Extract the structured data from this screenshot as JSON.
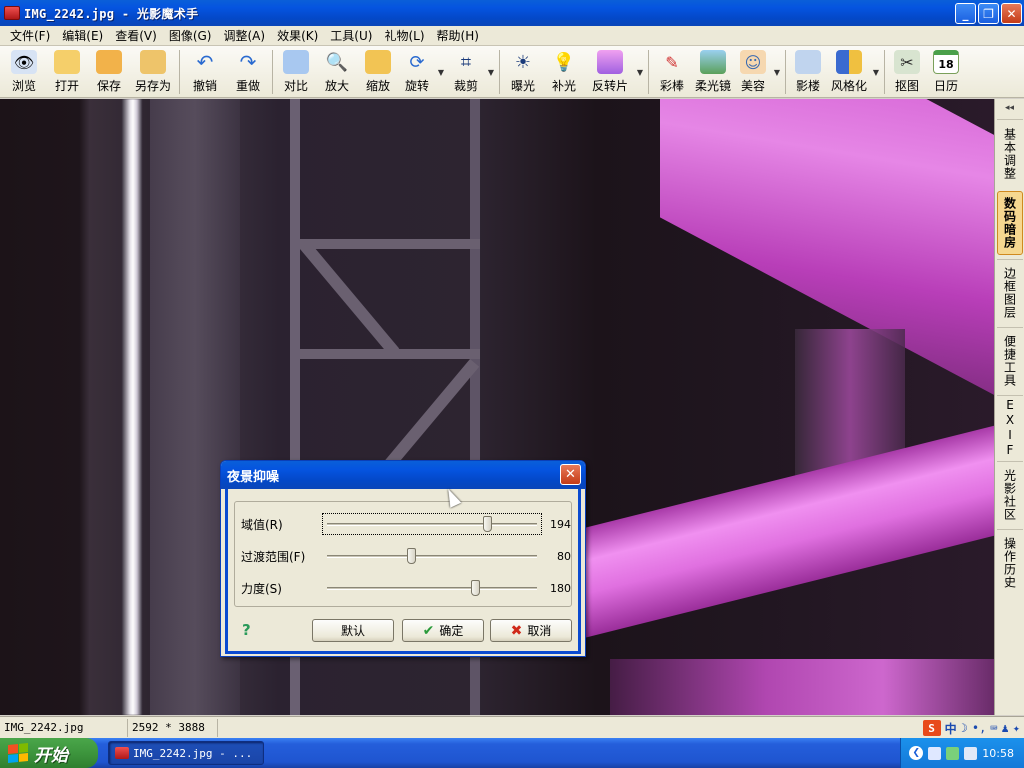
{
  "window": {
    "title": "IMG_2242.jpg - 光影魔术手",
    "controls": {
      "minimize": "_",
      "maximize": "❐",
      "close": "✕"
    }
  },
  "menu": [
    {
      "label": "文件(F)"
    },
    {
      "label": "编辑(E)"
    },
    {
      "label": "查看(V)"
    },
    {
      "label": "图像(G)"
    },
    {
      "label": "调整(A)"
    },
    {
      "label": "效果(K)"
    },
    {
      "label": "工具(U)"
    },
    {
      "label": "礼物(L)"
    },
    {
      "label": "帮助(H)"
    }
  ],
  "toolbar": [
    {
      "label": "浏览",
      "icon": "eye-icon"
    },
    {
      "label": "打开",
      "icon": "folder-icon"
    },
    {
      "label": "保存",
      "icon": "save-icon"
    },
    {
      "label": "另存为",
      "icon": "save-as-icon"
    },
    {
      "label": "撤销",
      "icon": "undo-icon"
    },
    {
      "label": "重做",
      "icon": "redo-icon"
    },
    {
      "label": "对比",
      "icon": "compare-icon"
    },
    {
      "label": "放大",
      "icon": "zoom-in-icon"
    },
    {
      "label": "缩放",
      "icon": "resize-icon"
    },
    {
      "label": "旋转",
      "icon": "rotate-icon"
    },
    {
      "label": "裁剪",
      "icon": "crop-icon"
    },
    {
      "label": "曝光",
      "icon": "exposure-icon"
    },
    {
      "label": "补光",
      "icon": "fill-light-icon"
    },
    {
      "label": "反转片",
      "icon": "film-icon"
    },
    {
      "label": "彩棒",
      "icon": "color-wand-icon"
    },
    {
      "label": "柔光镜",
      "icon": "soft-focus-icon"
    },
    {
      "label": "美容",
      "icon": "beauty-icon"
    },
    {
      "label": "影楼",
      "icon": "studio-icon"
    },
    {
      "label": "风格化",
      "icon": "stylize-icon"
    },
    {
      "label": "抠图",
      "icon": "cutout-icon"
    },
    {
      "label": "日历",
      "icon": "calendar-icon",
      "day": "18"
    }
  ],
  "side_tabs": [
    {
      "label": "基本调整"
    },
    {
      "label": "数码暗房",
      "active": true
    },
    {
      "label": "边框图层"
    },
    {
      "label": "便捷工具"
    },
    {
      "label": "EXIF"
    },
    {
      "label": "光影社区"
    },
    {
      "label": "操作历史"
    }
  ],
  "status": {
    "file": "IMG_2242.jpg (100%)",
    "size": "2592 * 3888"
  },
  "ime": {
    "logo": "S",
    "mode": "中"
  },
  "taskbar": {
    "start": "开始",
    "task": "IMG_2242.jpg - ...",
    "clock": "10:58"
  },
  "dialog": {
    "title": "夜景抑噪",
    "sliders": [
      {
        "label": "域值(R)",
        "value": 194,
        "max": 255,
        "focused": true
      },
      {
        "label": "过渡范围(F)",
        "value": 80,
        "max": 200
      },
      {
        "label": "力度(S)",
        "value": 180,
        "max": 255
      }
    ],
    "buttons": {
      "default": "默认",
      "ok": "确定",
      "cancel": "取消"
    }
  },
  "colors": {
    "title_blue": "#0554e0",
    "accent_orange": "#f6d890",
    "neon_magenta": "#f08cf0"
  }
}
